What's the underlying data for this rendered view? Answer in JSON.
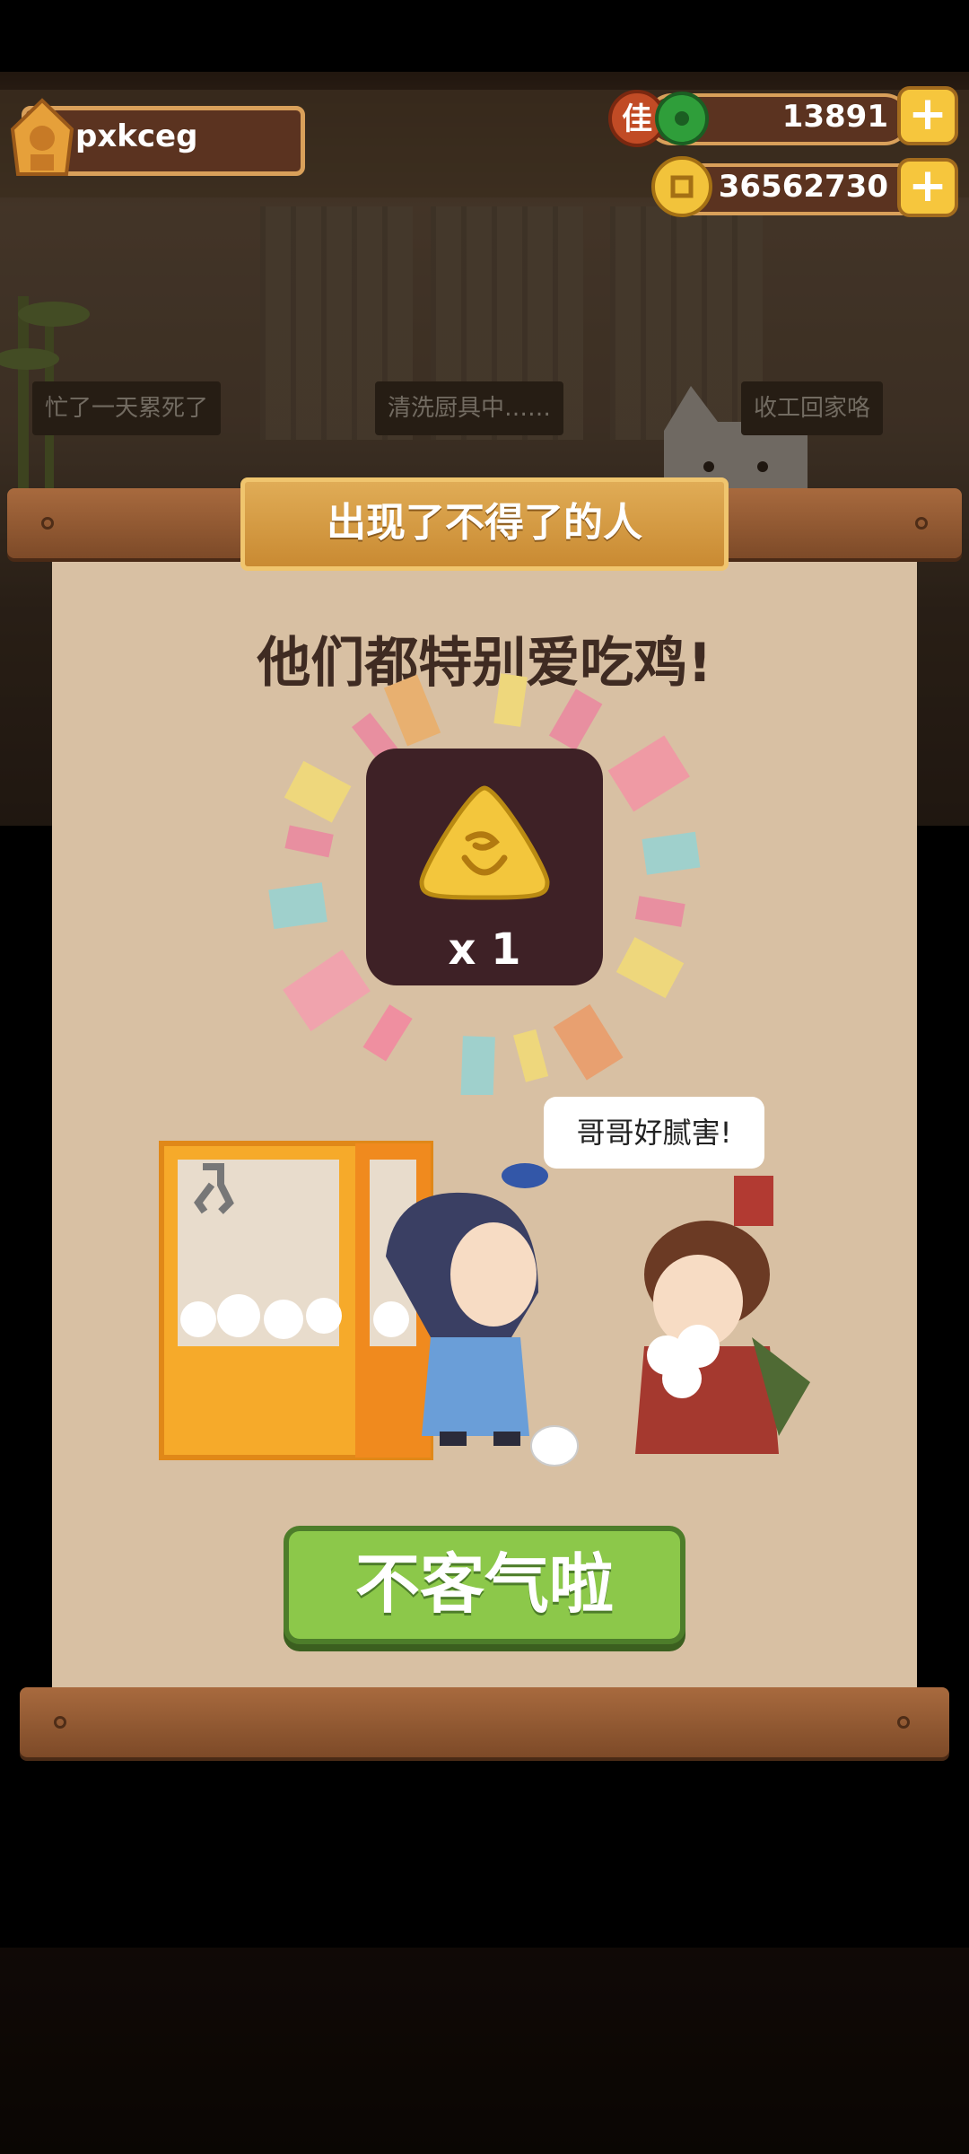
{
  "player": {
    "name": "pxkceg"
  },
  "resources": {
    "gems": {
      "badge": "佳",
      "value": "13891",
      "plus": "+"
    },
    "coins": {
      "value": "36562730",
      "plus": "+"
    }
  },
  "scene": {
    "bubbles": [
      "忙了一天累死了",
      "清洗厨具中……",
      "收工回家咯"
    ]
  },
  "dialog": {
    "title": "出现了不得了的人",
    "message": "他们都特别爱吃鸡!",
    "reward": {
      "icon": "golden-triangle-token-icon",
      "count": "x 1"
    },
    "speech": "哥哥好腻害!",
    "confirm_label": "不客气啦"
  },
  "colors": {
    "parchment": "#d8c0a3",
    "wood": "#8f5a34",
    "button_green": "#8cc84a",
    "gold": "#f6c63d"
  }
}
